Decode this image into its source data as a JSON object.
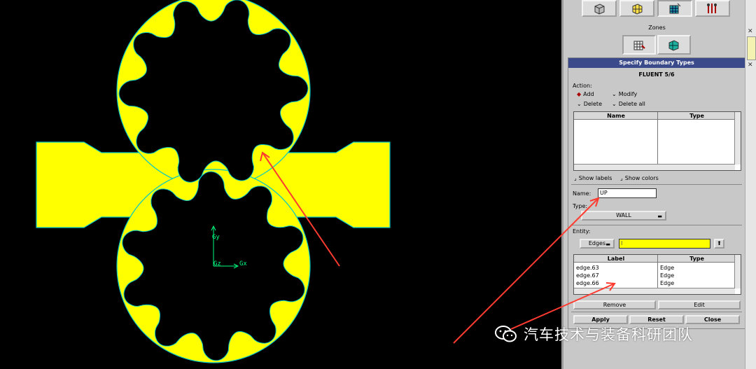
{
  "canvas": {
    "axis_y": "Gy",
    "axis_z": "Gz",
    "axis_x": "Gx",
    "mesh_color": "#ffff00",
    "edge_color": "#00c8c8"
  },
  "toolbar": {
    "icons": [
      "cube-icon",
      "mesh-cube-icon",
      "zone-icon",
      "tools-icon"
    ]
  },
  "zones": {
    "label": "Zones"
  },
  "dialog": {
    "title": "Specify Boundary Types",
    "solver": "FLUENT 5/6",
    "action_label": "Action:",
    "actions": {
      "add": "Add",
      "modify": "Modify",
      "delete": "Delete",
      "delete_all": "Delete all"
    },
    "top_table": {
      "col_name": "Name",
      "col_type": "Type"
    },
    "show_labels": "Show labels",
    "show_colors": "Show colors",
    "name_label": "Name:",
    "name_value": "UP",
    "type_label": "Type:",
    "type_value": "WALL",
    "entity_label": "Entity:",
    "entity_value": "Edges",
    "bottom_table": {
      "col_label": "Label",
      "col_type": "Type",
      "rows": [
        {
          "label": "edge.63",
          "type": "Edge"
        },
        {
          "label": "edge.67",
          "type": "Edge"
        },
        {
          "label": "edge.66",
          "type": "Edge"
        }
      ]
    },
    "remove_button": "Remove",
    "edit_button": "Edit",
    "apply_button": "Apply",
    "reset_button": "Reset",
    "close_button": "Close"
  },
  "watermark": {
    "text": "汽车技术与装备科研团队"
  },
  "accent": {
    "title_bar": "#3a4a8a",
    "entity_field": "#ffff00",
    "annotation_arrow": "#ff3b30"
  }
}
